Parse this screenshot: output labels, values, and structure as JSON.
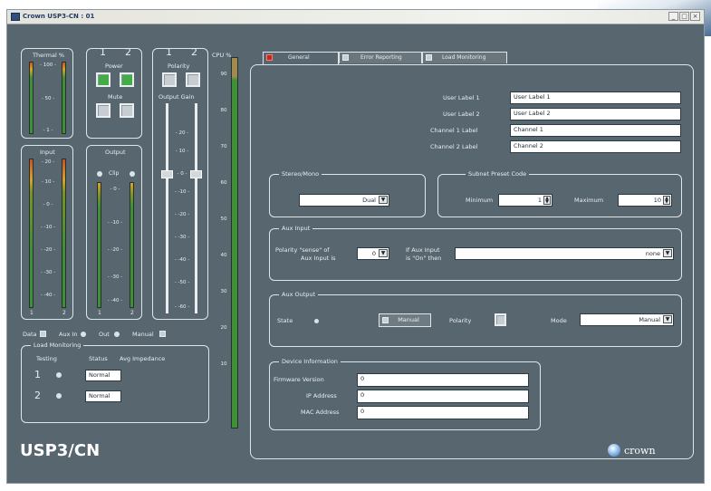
{
  "window": {
    "title": "Crown USP3-CN : 01",
    "controls": [
      "_",
      "□",
      "×"
    ],
    "icon": "app-icon"
  },
  "left": {
    "channel_header": {
      "ch1": "1",
      "ch2": "2"
    },
    "thermal": {
      "title": "Thermal %",
      "ticks": [
        "- 100 -",
        "- 50 -",
        "- 1 -"
      ]
    },
    "power": {
      "label": "Power"
    },
    "mute": {
      "label": "Mute"
    },
    "polarity": {
      "label": "Polarity"
    },
    "output_gain": {
      "label": "Output Gain",
      "ticks": [
        "- 20 -",
        "- 10 -",
        "- 0 -",
        "- -10 -",
        "- -20 -",
        "- -30 -",
        "- -40 -",
        "- -50 -",
        "- -60 -"
      ]
    },
    "input": {
      "title": "Input",
      "ticks": [
        "- 20 -",
        "- 10 -",
        "- 0 -",
        "- -10 -",
        "- -20 -",
        "- -30 -",
        "- -40 -"
      ],
      "foot": [
        "1",
        "2"
      ]
    },
    "output": {
      "title": "Output",
      "clip": "Clip",
      "ticks": [
        "- 0 -",
        "- -10 -",
        "- -20 -",
        "- -30 -",
        "- -40 -"
      ],
      "foot": [
        "1",
        "2"
      ]
    },
    "master": {
      "label": "CPU %",
      "ticks": [
        "90",
        "80",
        "70",
        "60",
        "50",
        "40",
        "30",
        "20",
        "10"
      ]
    },
    "indicators": {
      "data": "Data",
      "aux_in": "Aux In",
      "out": "Out",
      "manual": "Manual"
    },
    "load_monitoring": {
      "title": "Load Monitoring",
      "headers": [
        "Testing",
        "Status",
        "Avg Impedance"
      ],
      "rows": [
        {
          "ch": "1",
          "status": "Normal"
        },
        {
          "ch": "2",
          "status": "Normal"
        }
      ]
    }
  },
  "tabs": [
    {
      "label": "General"
    },
    {
      "label": "Error Reporting"
    },
    {
      "label": "Load Monitoring"
    }
  ],
  "labels_form": {
    "fields": [
      {
        "label": "User Label 1",
        "value": "User Label 1"
      },
      {
        "label": "User Label 2",
        "value": "User Label 2"
      },
      {
        "label": "Channel 1 Label",
        "value": "Channel 1"
      },
      {
        "label": "Channel 2 Label",
        "value": "Channel 2"
      }
    ]
  },
  "stereo_mono": {
    "title": "Stereo/Mono",
    "value": "Dual"
  },
  "subnet": {
    "title": "Subnet Preset Code",
    "min_label": "Minimum",
    "min_value": "1",
    "max_label": "Maximum",
    "max_value": "10"
  },
  "aux_input": {
    "title": "Aux Input",
    "polarity_label_1": "Polarity \"sense\" of",
    "polarity_label_2": "Aux Input is",
    "polarity_value": "0",
    "if_label_1": "If Aux Input",
    "if_label_2": "is \"On\" then",
    "action_value": "none"
  },
  "aux_output": {
    "title": "Aux Output",
    "state_label": "State",
    "manual_label": "Manual",
    "polarity_label": "Polarity",
    "mode_label": "Mode",
    "mode_value": "Manual"
  },
  "device_info": {
    "title": "Device Information",
    "fields": [
      {
        "label": "Firmware Version",
        "value": "0"
      },
      {
        "label": "IP Address",
        "value": "0"
      },
      {
        "label": "MAC Address",
        "value": "0"
      }
    ]
  },
  "footer": {
    "product": "USP3/CN",
    "brand": "crown"
  },
  "colors": {
    "background": "#58666f",
    "meter_green": "#3f8f37",
    "power_on": "#42ad45",
    "active_tab": "#c4271b"
  }
}
